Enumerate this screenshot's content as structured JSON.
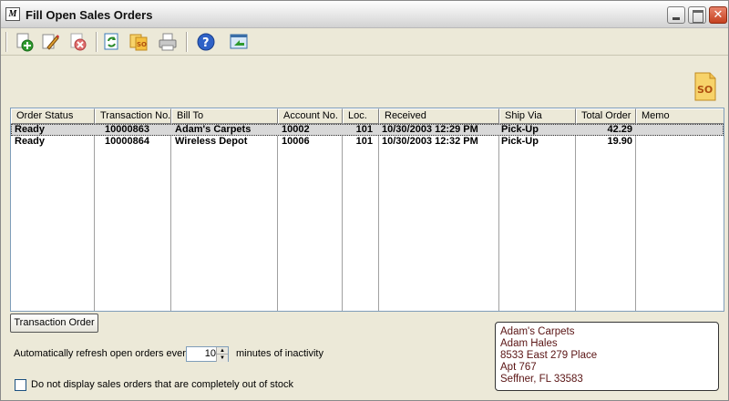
{
  "window": {
    "app_icon_letter": "M",
    "title": "Fill Open Sales Orders",
    "controls": {
      "minimize": "",
      "maximize": "",
      "close": "✕"
    }
  },
  "toolbar": {
    "icons": [
      "add-icon",
      "edit-icon",
      "delete-icon",
      "refresh-icon",
      "sales-order-icon",
      "print-icon",
      "help-icon",
      "export-icon"
    ]
  },
  "badge": {
    "label": "SO"
  },
  "grid": {
    "columns": [
      "Order Status",
      "Transaction No.",
      "Bill To",
      "Account No.",
      "Loc.",
      "Received",
      "Ship Via",
      "Total Order",
      "Memo"
    ],
    "rows": [
      {
        "status": "Ready",
        "transaction": "10000863",
        "bill_to": "Adam's Carpets",
        "account": "10002",
        "loc": "101",
        "received": "10/30/2003  12:29 PM",
        "ship_via": "Pick-Up",
        "total": "42.29",
        "memo": "",
        "selected": true
      },
      {
        "status": "Ready",
        "transaction": "10000864",
        "bill_to": "Wireless Depot",
        "account": "10006",
        "loc": "101",
        "received": "10/30/2003  12:32 PM",
        "ship_via": "Pick-Up",
        "total": "19.90",
        "memo": "",
        "selected": false
      }
    ]
  },
  "transaction_order_button": "Transaction Order",
  "refresh": {
    "label_before": "Automatically refresh open orders every",
    "value": "10",
    "label_after": "minutes of inactivity"
  },
  "out_of_stock_checkbox": {
    "label": "Do not display sales orders that are completely out of stock",
    "checked": false
  },
  "address": {
    "lines": [
      "Adam's Carpets",
      "Adam Hales",
      "8533 East 279 Place",
      "Apt 767",
      "Seffner, FL 33583"
    ]
  }
}
